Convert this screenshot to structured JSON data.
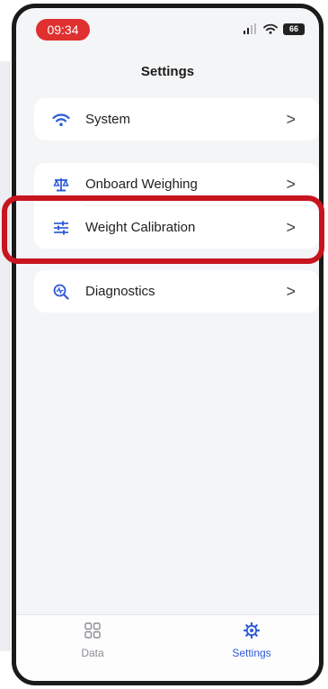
{
  "status_bar": {
    "time": "09:34",
    "battery": "66"
  },
  "header": {
    "title": "Settings"
  },
  "menu": {
    "system": {
      "label": "System",
      "icon": "wifi-icon"
    },
    "onboard_weighing": {
      "label": "Onboard Weighing",
      "icon": "scale-icon"
    },
    "weight_calibration": {
      "label": "Weight Calibration",
      "icon": "sliders-icon"
    },
    "diagnostics": {
      "label": "Diagnostics",
      "icon": "diagnostics-icon"
    },
    "chevron": ">"
  },
  "tabs": [
    {
      "label": "Data",
      "icon": "grid-icon",
      "active": false
    },
    {
      "label": "Settings",
      "icon": "gear-icon",
      "active": true
    }
  ],
  "colors": {
    "accent": "#2f5bd7",
    "highlight": "#c8141e",
    "time_pill": "#e03030",
    "background": "#f4f5f7"
  }
}
